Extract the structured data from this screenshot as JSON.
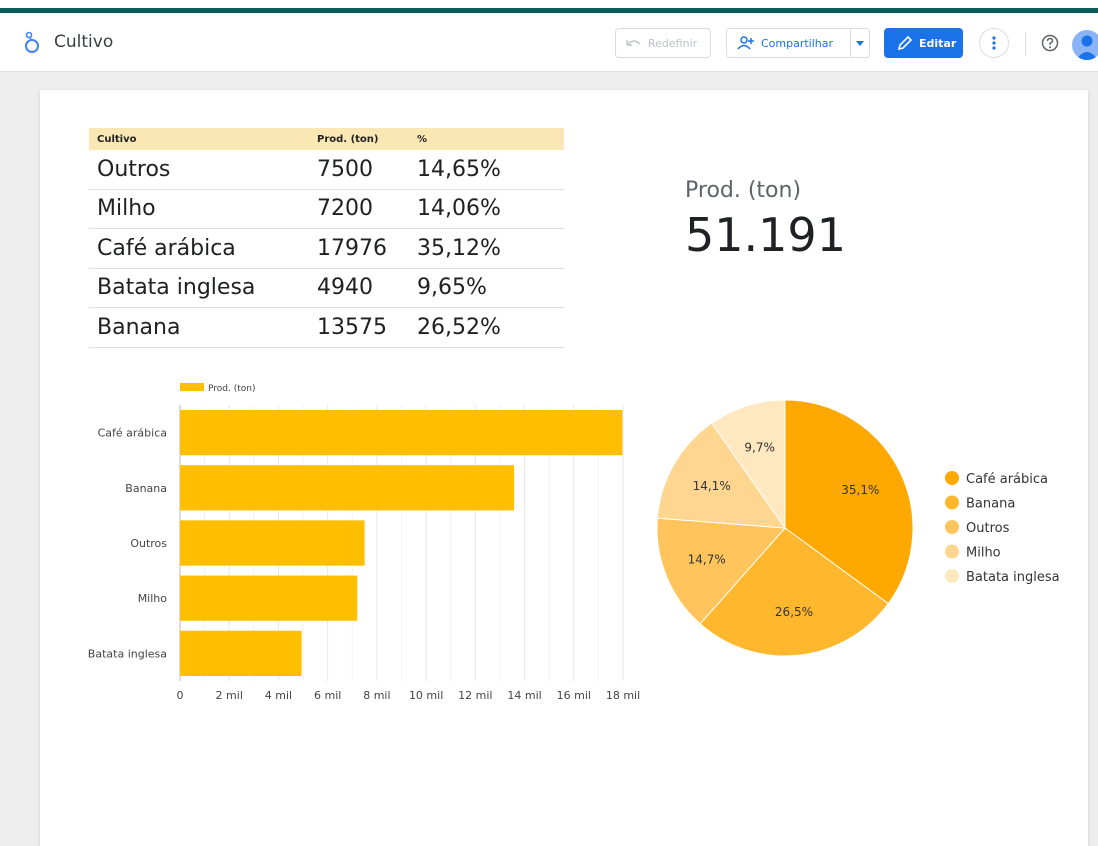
{
  "header": {
    "title": "Cultivo",
    "reset_label": "Redefinir",
    "share_label": "Compartilhar",
    "edit_label": "Editar"
  },
  "table": {
    "headers": [
      "Cultivo",
      "Prod. (ton)",
      "%"
    ],
    "rows": [
      [
        "Outros",
        "7500",
        "14,65%"
      ],
      [
        "Milho",
        "7200",
        "14,06%"
      ],
      [
        "Café arábica",
        "17976",
        "35,12%"
      ],
      [
        "Batata inglesa",
        "4940",
        "9,65%"
      ],
      [
        "Banana",
        "13575",
        "26,52%"
      ]
    ]
  },
  "scorecard": {
    "label": "Prod. (ton)",
    "value": "51.191"
  },
  "colors": {
    "accent": "#1a73e8",
    "bar": "#ffbf00",
    "header_bar": "#0c5e5a"
  },
  "chart_data": [
    {
      "type": "bar",
      "orientation": "horizontal",
      "categories": [
        "Café arábica",
        "Banana",
        "Outros",
        "Milho",
        "Batata inglesa"
      ],
      "series": [
        {
          "name": "Prod. (ton)",
          "values": [
            17976,
            13575,
            7500,
            7200,
            4940
          ]
        }
      ],
      "xlim": [
        0,
        18000
      ],
      "x_ticks": [
        "0",
        "2 mil",
        "4 mil",
        "6 mil",
        "8 mil",
        "10 mil",
        "12 mil",
        "14 mil",
        "16 mil",
        "18 mil"
      ],
      "legend": "top",
      "grid": true,
      "color": "#ffbf00"
    },
    {
      "type": "pie",
      "labels": [
        "Café arábica",
        "Banana",
        "Outros",
        "Milho",
        "Batata inglesa"
      ],
      "values": [
        35.1,
        26.5,
        14.7,
        14.1,
        9.7
      ],
      "data_labels": [
        "35,1%",
        "26,5%",
        "14,7%",
        "14,1%",
        "9,7%"
      ],
      "colors": [
        "#ffa800",
        "#ffb82e",
        "#ffc55c",
        "#ffd68f",
        "#ffe7bf"
      ],
      "legend": "right"
    }
  ]
}
